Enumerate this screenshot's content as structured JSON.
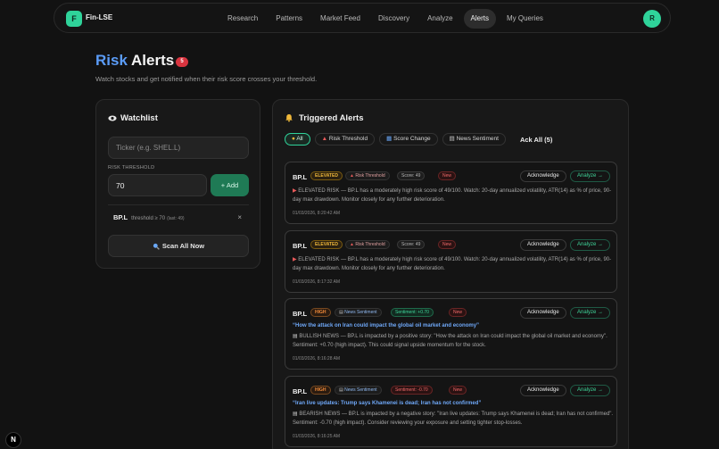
{
  "nav": {
    "logo_letter": "F",
    "brand": "Fin-LSE",
    "links": [
      "Research",
      "Patterns",
      "Market Feed",
      "Discovery",
      "Analyze",
      "Alerts",
      "My Queries"
    ],
    "active": "Alerts",
    "avatar_letter": "R"
  },
  "page": {
    "title_accent": "Risk",
    "title_rest": " Alerts",
    "badge_count": "5",
    "subtitle": "Watch stocks and get notified when their risk score crosses your threshold."
  },
  "watchlist": {
    "title": "Watchlist",
    "ticker_placeholder": "Ticker (e.g. SHEL.L)",
    "threshold_label": "RISK THRESHOLD",
    "threshold_value": "70",
    "add_label": "+ Add",
    "item": {
      "symbol": "BP.L",
      "threshold_text": "threshold ≥ 70",
      "last_text": "(last: 49)",
      "remove": "×"
    },
    "scan_label": "Scan All Now"
  },
  "alerts": {
    "title": "Triggered Alerts",
    "filters": [
      "All",
      "Risk Threshold",
      "Score Change",
      "News Sentiment"
    ],
    "active_filter": "All",
    "ack_all_label": "Ack All (5)",
    "acknowledge_label": "Acknowledge",
    "analyze_label": "Analyze →",
    "new_label": "New",
    "cards": [
      {
        "symbol": "BP.L",
        "level": "ELEVATED",
        "type": "Risk Threshold",
        "metric": "Score: 49",
        "message": "ELEVATED RISK — BP.L has a moderately high risk score of 49/100. Watch: 20-day annualized volatility, ATR(14) as % of price, 90-day max drawdown. Monitor closely for any further deterioration.",
        "time": "01/03/2026, 8:20:42 AM"
      },
      {
        "symbol": "BP.L",
        "level": "ELEVATED",
        "type": "Risk Threshold",
        "metric": "Score: 49",
        "message": "ELEVATED RISK — BP.L has a moderately high risk score of 49/100. Watch: 20-day annualized volatility, ATR(14) as % of price, 90-day max drawdown. Monitor closely for any further deterioration.",
        "time": "01/03/2026, 8:17:32 AM"
      },
      {
        "symbol": "BP.L",
        "level": "HIGH",
        "type": "News Sentiment",
        "metric": "Sentiment: +0.70",
        "headline": "“How the attack on Iran could impact the global oil market and economy”",
        "message": "BULLISH NEWS — BP.L is impacted by a positive story: \"How the attack on Iran could impact the global oil market and economy\". Sentiment: +0.70 (high impact). This could signal upside momentum for the stock.",
        "time": "01/03/2026, 8:16:28 AM"
      },
      {
        "symbol": "BP.L",
        "level": "HIGH",
        "type": "News Sentiment",
        "metric": "Sentiment: -0.70",
        "headline": "“Iran live updates: Trump says Khamenei is dead; Iran has not confirmed”",
        "message": "BEARISH NEWS — BP.L is impacted by a negative story: \"Iran live updates: Trump says Khamenei is dead; Iran has not confirmed\". Sentiment: -0.70 (high impact). Consider reviewing your exposure and setting tighter stop-losses.",
        "time": "01/03/2026, 8:16:25 AM"
      }
    ]
  },
  "fab_letter": "N"
}
